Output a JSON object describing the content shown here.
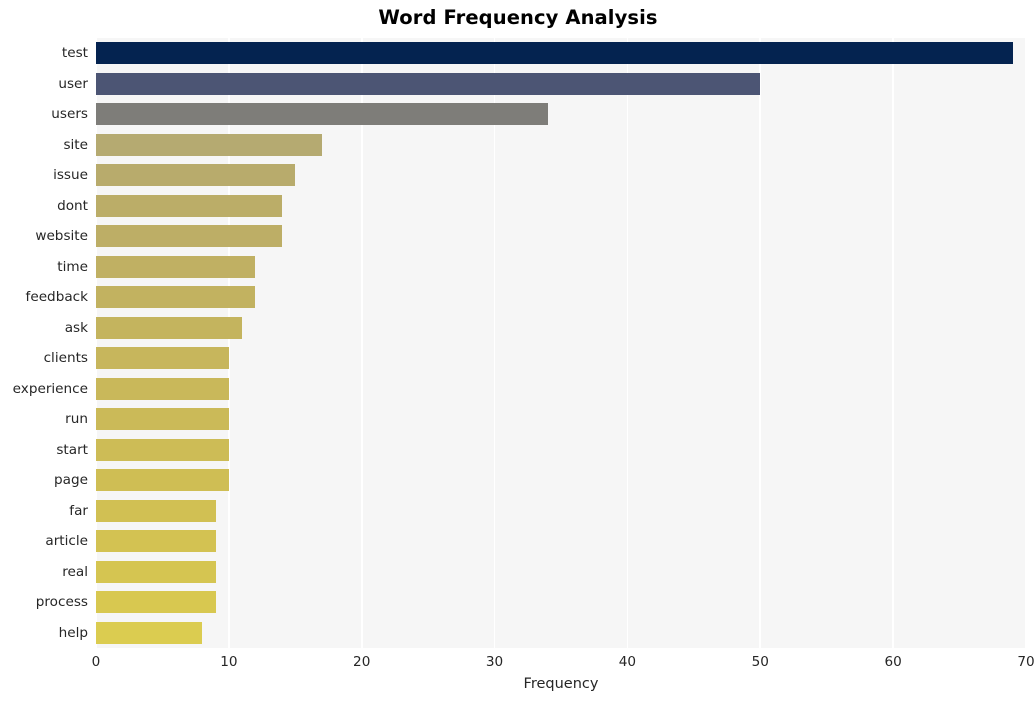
{
  "chart_data": {
    "type": "bar",
    "orientation": "horizontal",
    "title": "Word Frequency Analysis",
    "xlabel": "Frequency",
    "ylabel": "",
    "xlim": [
      0,
      70
    ],
    "xticks": [
      0,
      10,
      20,
      30,
      40,
      50,
      60,
      70
    ],
    "xtick_labels": [
      "0",
      "10",
      "20",
      "30",
      "40",
      "50",
      "60",
      "70"
    ],
    "grid": "vertical",
    "legend": "none",
    "categories": [
      "test",
      "user",
      "users",
      "site",
      "issue",
      "dont",
      "website",
      "time",
      "feedback",
      "ask",
      "clients",
      "experience",
      "run",
      "start",
      "page",
      "far",
      "article",
      "real",
      "process",
      "help"
    ],
    "values": [
      69,
      50,
      34,
      17,
      15,
      14,
      14,
      12,
      12,
      11,
      10,
      10,
      10,
      10,
      10,
      9,
      9,
      9,
      9,
      8
    ],
    "bar_colors": [
      "#042350",
      "#4c5574",
      "#7e7d79",
      "#b5aa71",
      "#b8ab6c",
      "#bbad68",
      "#bdae66",
      "#c0b063",
      "#c2b260",
      "#c4b45e",
      "#c7b65c",
      "#c9b85a",
      "#cbba58",
      "#cdbc56",
      "#cfbe54",
      "#d1c053",
      "#d3c252",
      "#d5c551",
      "#d8c850",
      "#dbcc50"
    ],
    "plot_background": "#f6f6f6",
    "gridline_color": "#ffffff",
    "figure_background": "#ffffff",
    "text_color": "#262626"
  }
}
